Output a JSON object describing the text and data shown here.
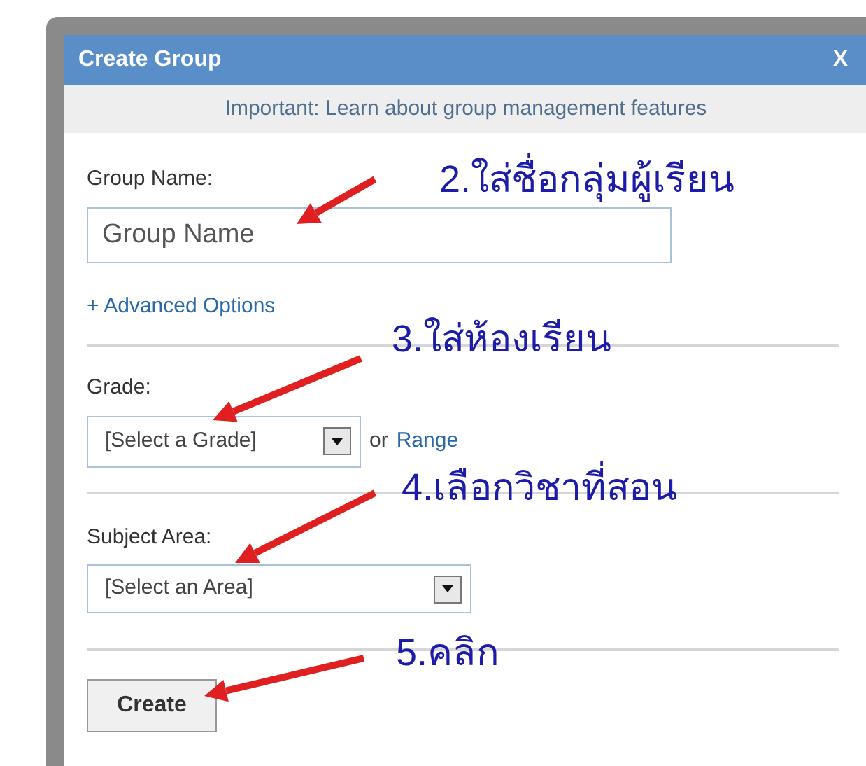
{
  "dialog": {
    "title": "Create Group",
    "close": "X",
    "notice": "Important: Learn about group management features"
  },
  "group_name": {
    "label": "Group Name:",
    "placeholder": "Group Name"
  },
  "advanced_link": "+ Advanced Options",
  "grade": {
    "label": "Grade:",
    "value": "[Select a Grade]",
    "or": "or",
    "range_link": "Range"
  },
  "subject": {
    "label": "Subject Area:",
    "value": "[Select an Area]"
  },
  "create_button": "Create",
  "annotations": [
    {
      "text": "2.ใส่ชื่อกลุ่มผู้เรียน"
    },
    {
      "text": "3.ใส่ห้องเรียน"
    },
    {
      "text": "4.เลือกวิชาที่สอน"
    },
    {
      "text": "5.คลิก"
    }
  ]
}
